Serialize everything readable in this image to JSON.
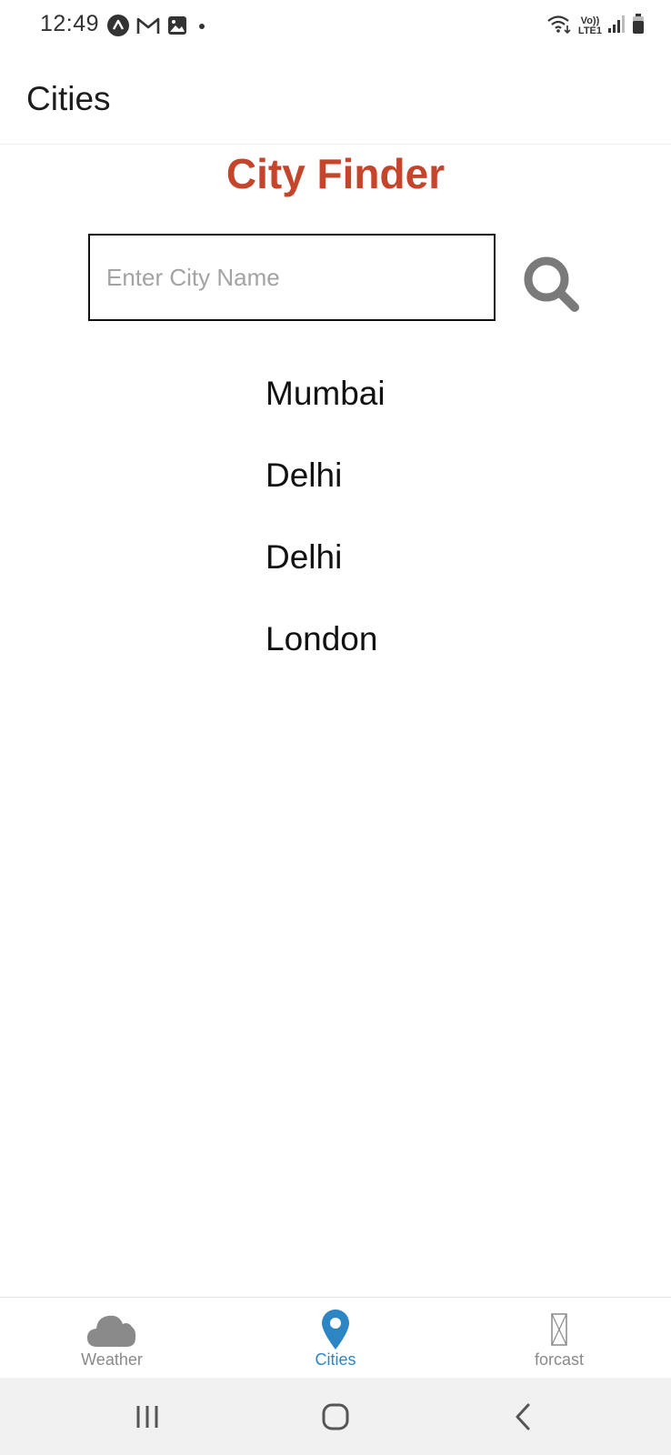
{
  "status_bar": {
    "time": "12:49",
    "network_label": "LTE1",
    "volte_label": "Vo))",
    "icons": [
      "app-notification-icon",
      "gmail-icon",
      "gallery-icon",
      "dot-icon",
      "wifi-icon",
      "signal-icon",
      "battery-icon"
    ]
  },
  "header": {
    "title": "Cities"
  },
  "finder": {
    "title": "City Finder",
    "title_color": "#c4452c",
    "search_placeholder": "Enter City Name",
    "search_value": "",
    "search_icon": "search-icon"
  },
  "cities": [
    {
      "name": "Mumbai"
    },
    {
      "name": "Delhi"
    },
    {
      "name": "Delhi"
    },
    {
      "name": "London"
    }
  ],
  "tabs": [
    {
      "label": "Weather",
      "icon": "cloud-icon",
      "active": false
    },
    {
      "label": "Cities",
      "icon": "map-pin-icon",
      "active": true
    },
    {
      "label": "forcast",
      "icon": "missing-image-icon",
      "active": false
    }
  ],
  "colors": {
    "active_tab": "#2d86c4",
    "inactive": "#8a8a8a"
  },
  "nav_bar": {
    "buttons": [
      "recent-apps-icon",
      "home-icon",
      "back-icon"
    ]
  }
}
